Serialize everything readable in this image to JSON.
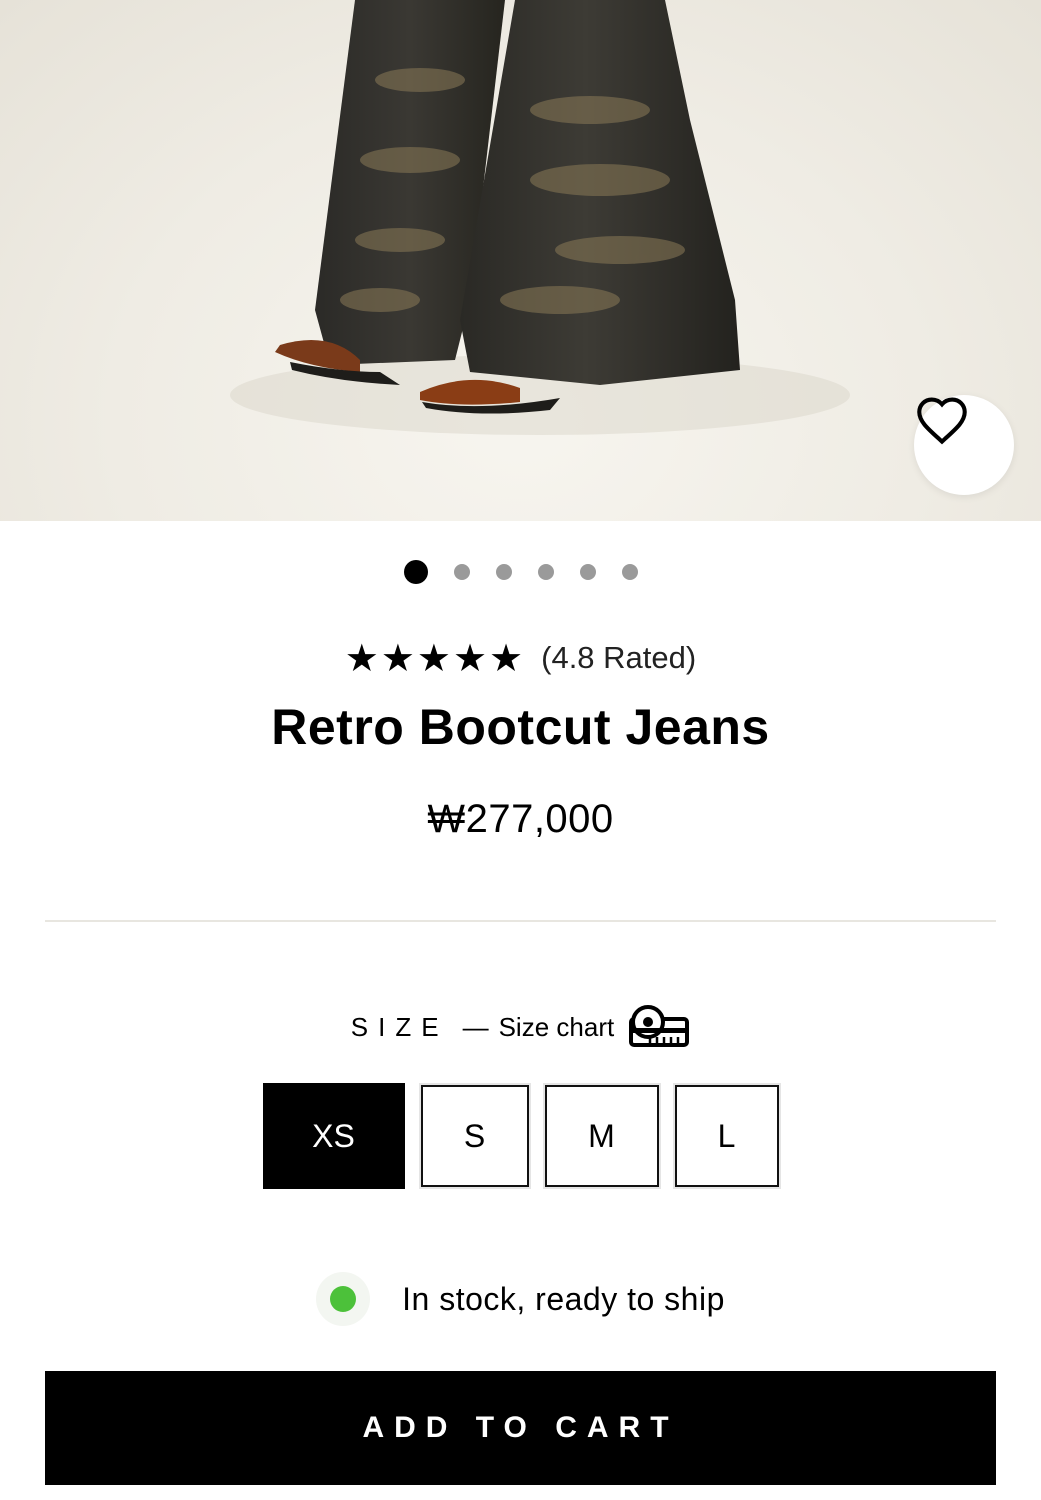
{
  "gallery": {
    "image_alt": "Retro Bootcut Jeans product photo",
    "slide_count": 6,
    "active_slide": 0,
    "wishlist_icon": "heart-icon"
  },
  "product": {
    "stars": "★★★★★",
    "rating_value": 4.8,
    "rating_text": "(4.8 Rated)",
    "title": "Retro Bootcut Jeans",
    "price": "₩277,000"
  },
  "size": {
    "label": "SIZE",
    "dash": "—",
    "chart_label": "Size chart",
    "chart_icon": "ruler-icon",
    "options": [
      "XS",
      "S",
      "M",
      "L"
    ],
    "selected": "XS"
  },
  "stock": {
    "text": "In stock, ready to ship",
    "color": "#4cc13a"
  },
  "cart": {
    "label": "ADD TO CART"
  }
}
